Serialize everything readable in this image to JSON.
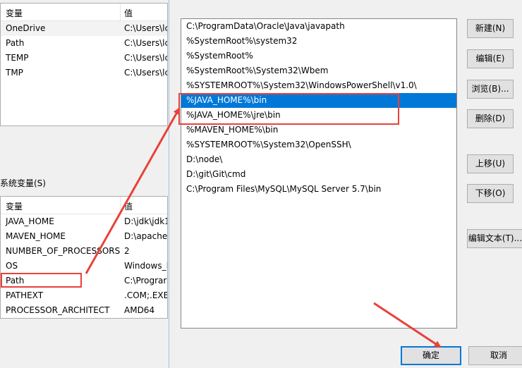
{
  "user_vars": {
    "col_name": "变量",
    "col_value": "值",
    "rows": [
      {
        "name": "OneDrive",
        "value": "C:\\Users\\lc"
      },
      {
        "name": "Path",
        "value": "C:\\Users\\lc"
      },
      {
        "name": "TEMP",
        "value": "C:\\Users\\lc"
      },
      {
        "name": "TMP",
        "value": "C:\\Users\\lc"
      }
    ]
  },
  "system_vars": {
    "title": "系统变量(S)",
    "col_name": "变量",
    "col_value": "值",
    "rows": [
      {
        "name": "JAVA_HOME",
        "value": "D:\\jdk\\jdk1"
      },
      {
        "name": "MAVEN_HOME",
        "value": "D:\\apache"
      },
      {
        "name": "NUMBER_OF_PROCESSORS",
        "value": "2"
      },
      {
        "name": "OS",
        "value": "Windows_N"
      },
      {
        "name": "Path",
        "value": "C:\\Prograr"
      },
      {
        "name": "PATHEXT",
        "value": ".COM;.EXE"
      },
      {
        "name": "PROCESSOR_ARCHITECT",
        "value": "AMD64"
      }
    ]
  },
  "path_entries": [
    "C:\\ProgramData\\Oracle\\Java\\javapath",
    "%SystemRoot%\\system32",
    "%SystemRoot%",
    "%SystemRoot%\\System32\\Wbem",
    "%SYSTEMROOT%\\System32\\WindowsPowerShell\\v1.0\\",
    "%JAVA_HOME%\\bin",
    "%JAVA_HOME%\\jre\\bin",
    "%MAVEN_HOME%\\bin",
    "%SYSTEMROOT%\\System32\\OpenSSH\\",
    "D:\\node\\",
    "D:\\git\\Git\\cmd",
    "C:\\Program Files\\MySQL\\MySQL Server 5.7\\bin"
  ],
  "buttons": {
    "new": "新建(N)",
    "edit": "编辑(E)",
    "browse": "浏览(B)...",
    "delete": "删除(D)",
    "move_up": "上移(U)",
    "move_down": "下移(O)",
    "edit_text": "编辑文本(T)...",
    "ok": "确定",
    "cancel": "取消"
  },
  "colors": {
    "selection": "#0078d7",
    "annotation": "#e8413a"
  }
}
